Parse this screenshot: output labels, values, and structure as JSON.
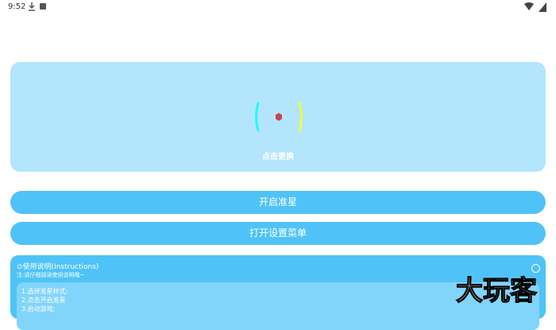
{
  "status": {
    "time": "9:52"
  },
  "preview": {
    "change_label": "点击更换"
  },
  "buttons": {
    "open_crosshair": "开启准星",
    "open_settings": "打开设置菜单"
  },
  "instructions": {
    "title": "⊙使用说明(Instructions)",
    "note": "注:请仔细阅读使用说明哦~",
    "steps": [
      "1.选择准星样式;",
      "2.点击开启准星",
      "3.启动游戏;"
    ]
  },
  "watermark": {
    "text": "大玩客"
  },
  "colors": {
    "accent": "#4fc3f7",
    "card": "#b3e5fc",
    "inner": "#81d4fa"
  }
}
